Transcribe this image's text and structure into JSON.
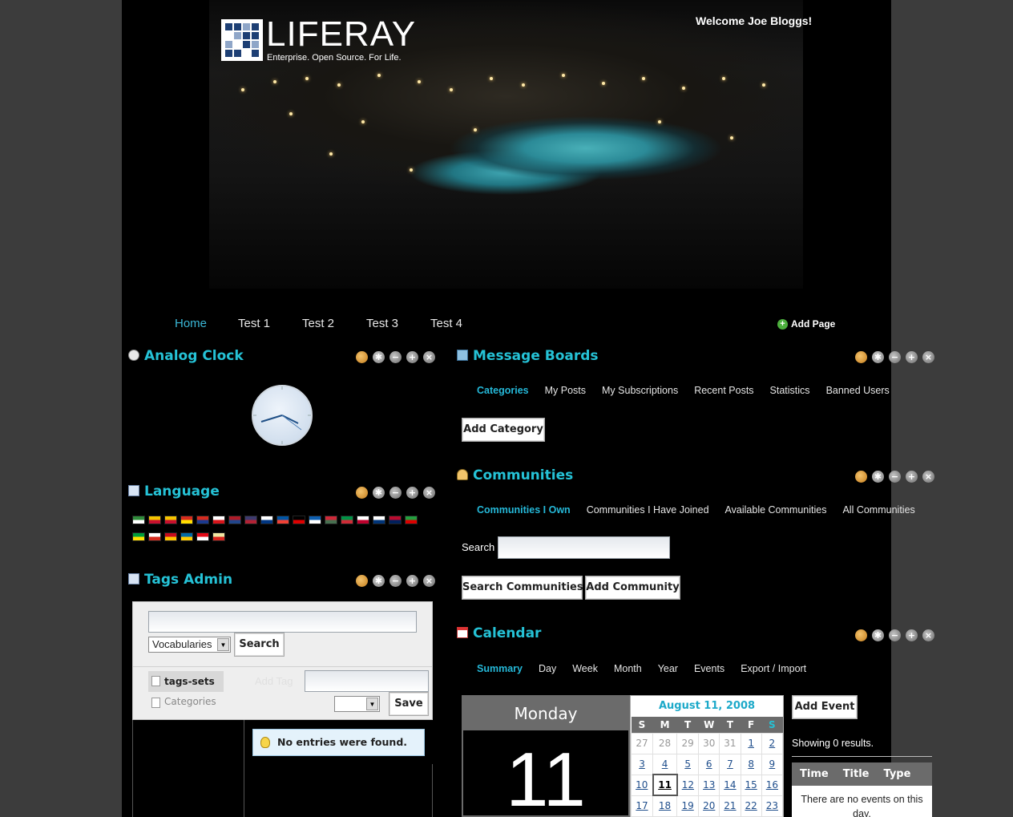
{
  "header": {
    "logo_text": "LIFERAY",
    "logo_tagline": "Enterprise. Open Source. For Life.",
    "welcome": "Welcome Joe Bloggs!"
  },
  "nav": {
    "tabs": [
      "Home",
      "Test 1",
      "Test 2",
      "Test 3",
      "Test 4"
    ],
    "active_tab": "Home",
    "add_page": "Add Page"
  },
  "analog_clock": {
    "title": "Analog Clock",
    "time_hour": 2,
    "time_minute": 19
  },
  "language": {
    "title": "Language",
    "flags_row1": [
      "arabic-flag",
      "catalan-flag",
      "catalan-flag-2",
      "chinese-flag",
      "taiwan-flag",
      "czech-flag",
      "dutch-flag",
      "english-flag",
      "finnish-flag",
      "french-flag",
      "german-flag",
      "greek-flag",
      "hungarian-flag",
      "italian-flag",
      "japanese-flag",
      "korean-flag",
      "norwegian-flag",
      "persian-flag"
    ],
    "flags_row2": [
      "portuguese-flag",
      "russian-flag",
      "spanish-flag",
      "swedish-flag",
      "turkish-flag",
      "vietnamese-flag"
    ]
  },
  "tags_admin": {
    "title": "Tags Admin",
    "search_value": "",
    "vocabulary_select": "Vocabularies",
    "search_button": "Search",
    "sets": [
      "tags-sets",
      "Categories"
    ],
    "add_tag_placeholder": "Add Tag",
    "add_tag_value": "",
    "save_button": "Save",
    "empty_message": "No entries were found."
  },
  "message_boards": {
    "title": "Message Boards",
    "tabs": [
      "Categories",
      "My Posts",
      "My Subscriptions",
      "Recent Posts",
      "Statistics",
      "Banned Users"
    ],
    "active_tab": "Categories",
    "add_category": "Add Category"
  },
  "communities": {
    "title": "Communities",
    "tabs": [
      "Communities I Own",
      "Communities I Have Joined",
      "Available Communities",
      "All Communities"
    ],
    "active_tab": "Communities I Own",
    "search_label": "Search",
    "search_value": "",
    "search_button": "Search Communities",
    "add_button": "Add Community"
  },
  "calendar": {
    "title": "Calendar",
    "tabs": [
      "Summary",
      "Day",
      "Week",
      "Month",
      "Year",
      "Events",
      "Export / Import"
    ],
    "active_tab": "Summary",
    "day_name": "Monday",
    "day_number": "11",
    "month_label": "August 11, 2008",
    "weekdays": [
      "S",
      "M",
      "T",
      "W",
      "T",
      "F",
      "S"
    ],
    "weeks": [
      [
        "27",
        "28",
        "29",
        "30",
        "31",
        "1",
        "2"
      ],
      [
        "3",
        "4",
        "5",
        "6",
        "7",
        "8",
        "9"
      ],
      [
        "10",
        "11",
        "12",
        "13",
        "14",
        "15",
        "16"
      ],
      [
        "17",
        "18",
        "19",
        "20",
        "21",
        "22",
        "23"
      ]
    ],
    "today": "11",
    "add_event": "Add Event",
    "showing": "Showing 0 results.",
    "event_columns": [
      "Time",
      "Title",
      "Type"
    ],
    "no_events": "There are no events on this day."
  },
  "colors": {
    "accent": "#25c2d6",
    "page_bg": "#000000",
    "outer_bg": "#3c3c3c"
  }
}
